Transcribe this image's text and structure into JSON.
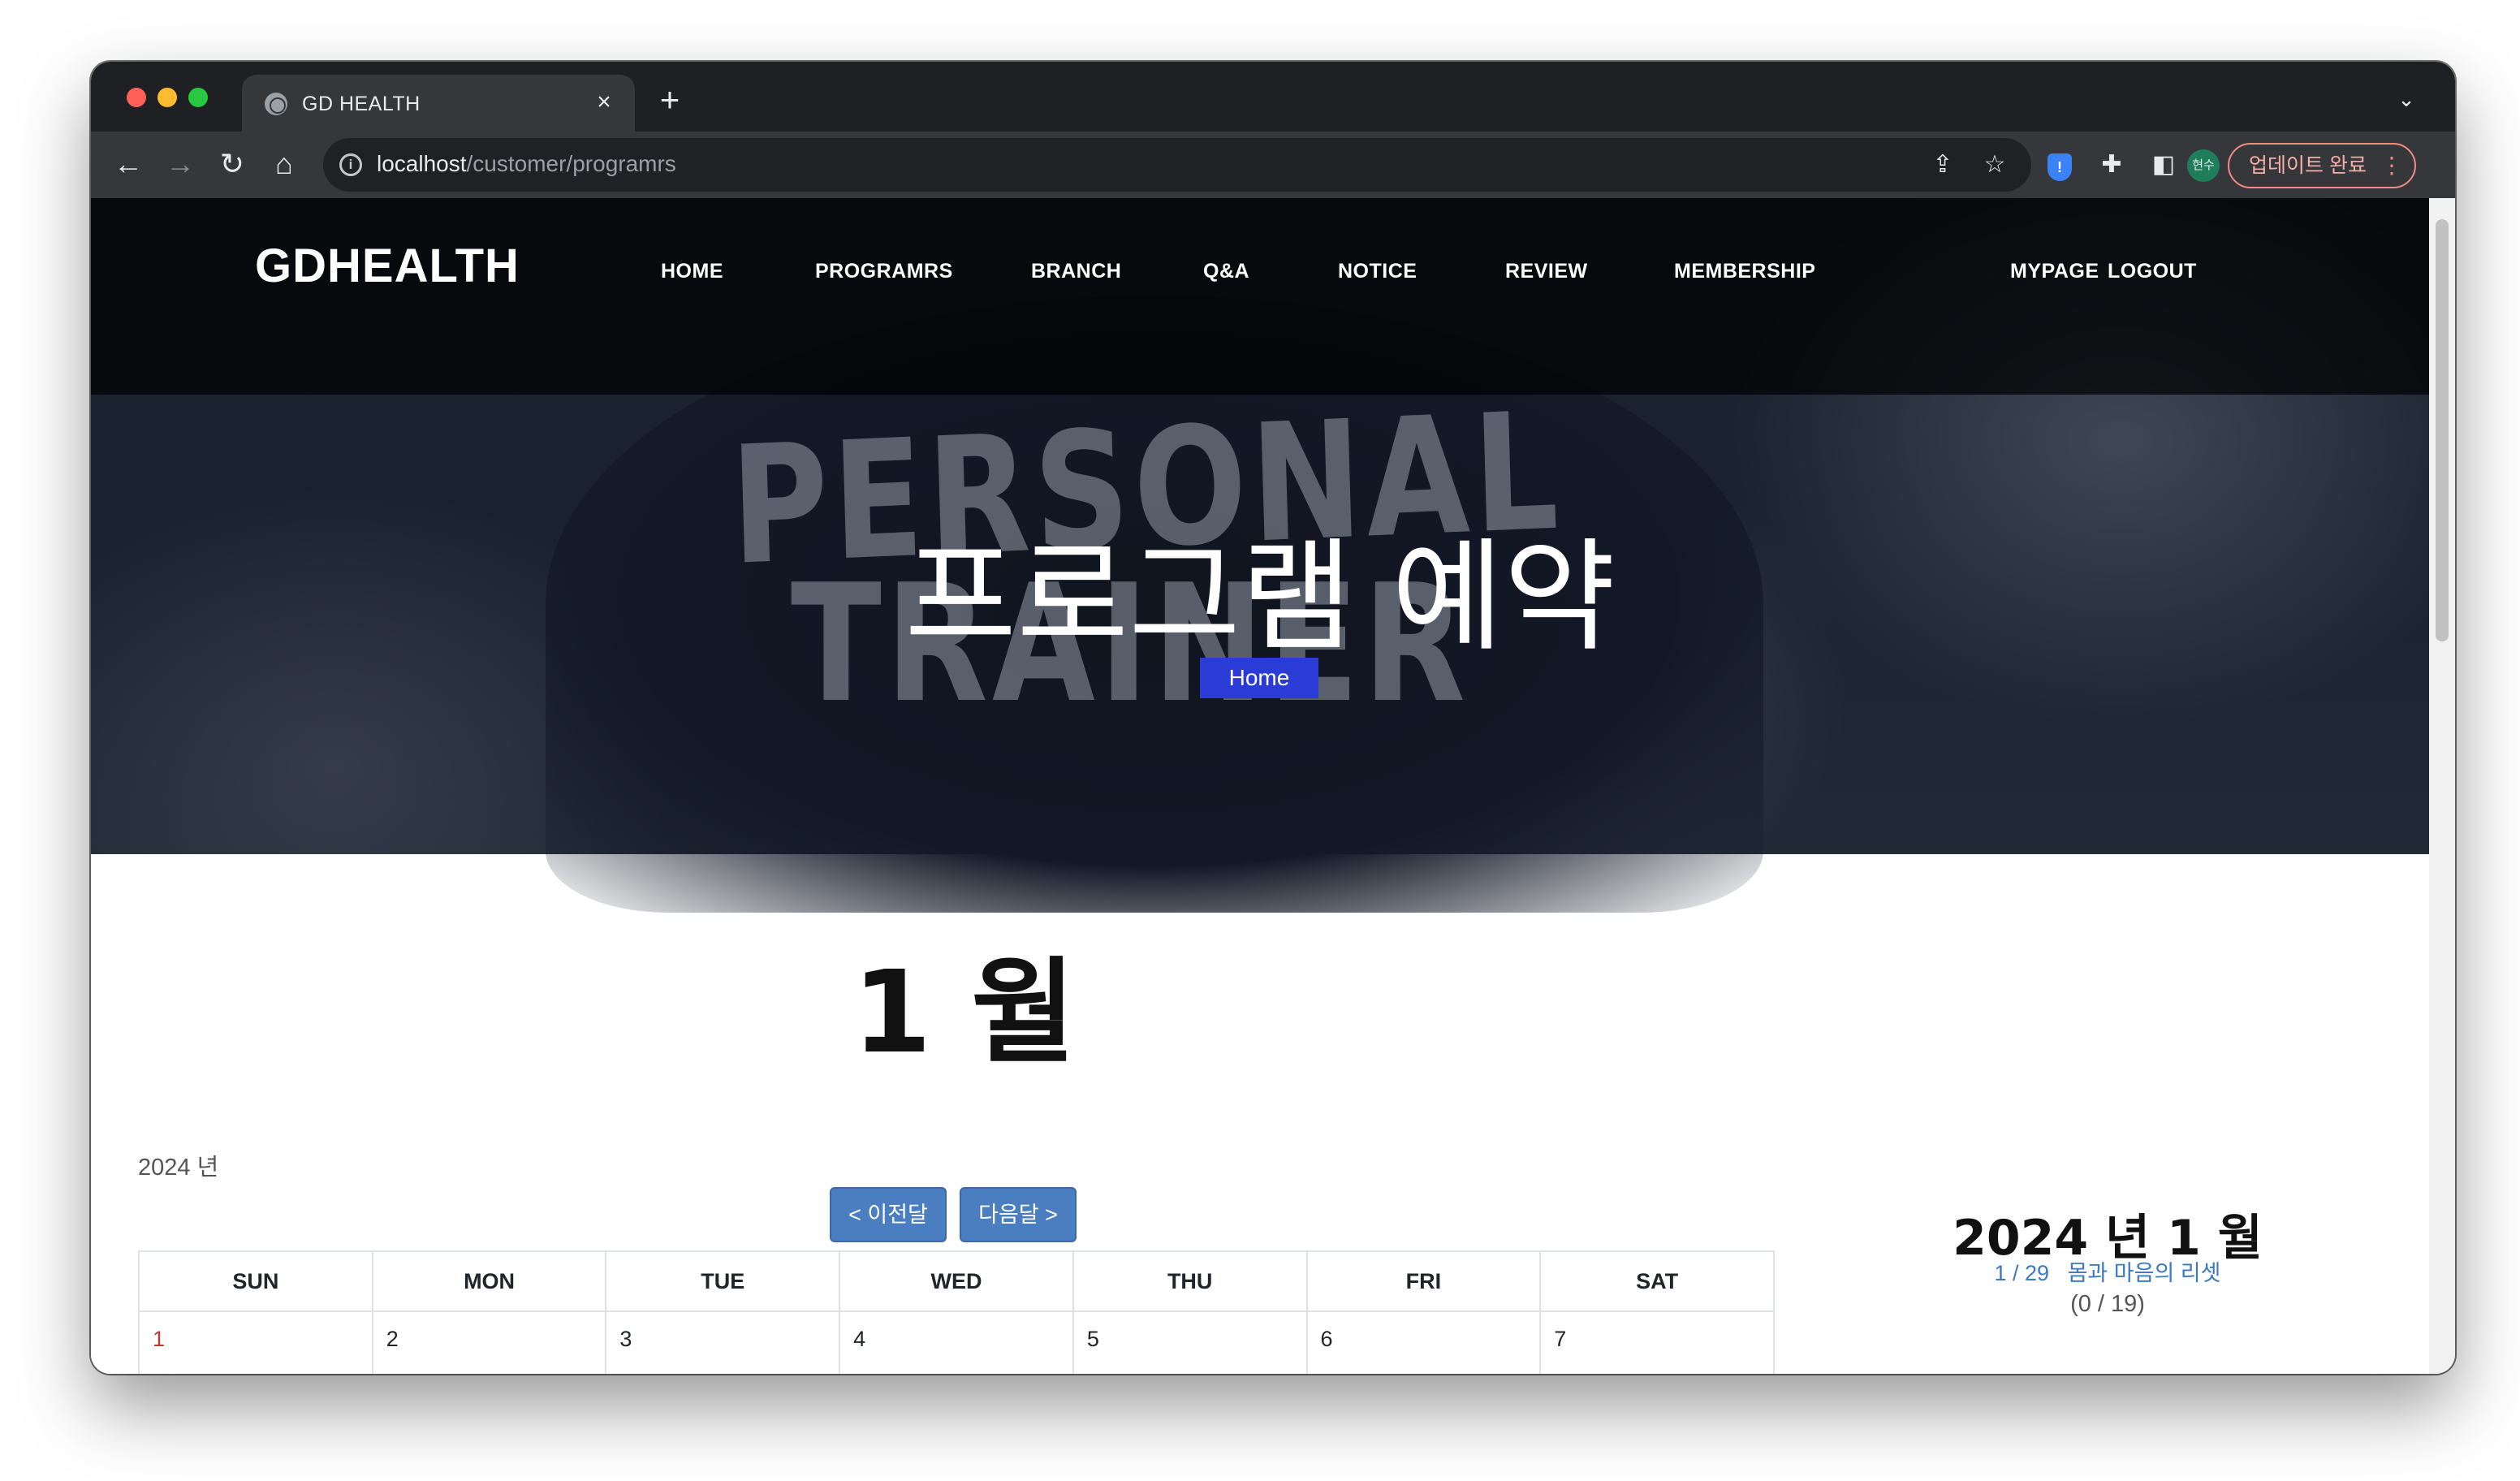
{
  "browser": {
    "tab_title": "GD HEALTH",
    "tab_close": "×",
    "new_tab": "+",
    "tab_menu": "⌄",
    "url_host": "localhost",
    "url_path": "/customer/programrs",
    "profile_initials": "현수",
    "update_label": "업데이트 완료",
    "update_menu": "⋮"
  },
  "site": {
    "logo": "GDHEALTH",
    "nav": {
      "home": "HOME",
      "programs": "PROGRAMRS",
      "branch": "BRANCH",
      "qa": "Q&A",
      "notice": "NOTICE",
      "review": "REVIEW",
      "membership": "MEMBERSHIP",
      "mypage": "MYPAGE",
      "logout": "LOGOUT"
    },
    "hero": {
      "title": "프로그램 예약",
      "breadcrumb": "Home",
      "background_print": [
        "PERSONAL",
        "TRAINER"
      ]
    }
  },
  "calendar": {
    "month_heading": "1 월",
    "year_label": "2024 년",
    "prev_label": "< 이전달",
    "next_label": "다음달 >",
    "weekdays": [
      "SUN",
      "MON",
      "TUE",
      "WED",
      "THU",
      "FRI",
      "SAT"
    ],
    "first_week": [
      "1",
      "2",
      "3",
      "4",
      "5",
      "6",
      "7"
    ]
  },
  "side_panel": {
    "title": "2024 년 1 월",
    "event_date": "1 / 29",
    "event_name": "몸과 마음의 리셋",
    "event_count": "(0 / 19)"
  },
  "colors": {
    "breadcrumb_bg": "#2a3bd6",
    "month_button_bg": "#4a7ec0",
    "sunday_text": "#c0392b",
    "event_link": "#3b79c4",
    "update_border": "#f28b82"
  },
  "icons": [
    "globe-icon",
    "close-icon",
    "plus-icon",
    "chevron-down-icon",
    "back-arrow-icon",
    "forward-arrow-icon",
    "reload-icon",
    "home-icon",
    "info-icon",
    "share-icon",
    "star-icon",
    "shield-extension-icon",
    "puzzle-icon",
    "sidebar-icon",
    "kebab-menu-icon"
  ]
}
